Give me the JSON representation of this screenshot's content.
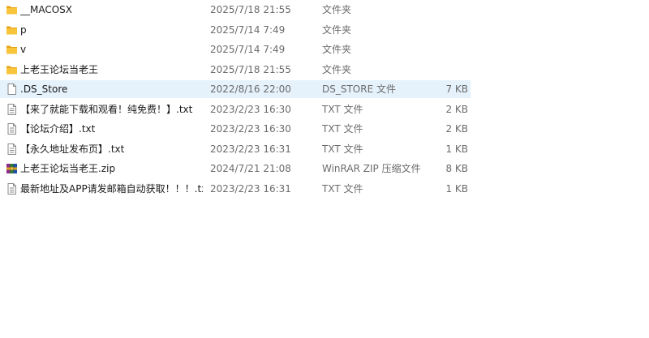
{
  "files": [
    {
      "name": "__MACOSX",
      "date": "2025/7/18 21:55",
      "type": "文件夹",
      "size": "",
      "icon": "folder-icon"
    },
    {
      "name": "p",
      "date": "2025/7/14 7:49",
      "type": "文件夹",
      "size": "",
      "icon": "folder-icon"
    },
    {
      "name": "v",
      "date": "2025/7/14 7:49",
      "type": "文件夹",
      "size": "",
      "icon": "folder-icon"
    },
    {
      "name": "上老王论坛当老王",
      "date": "2025/7/18 21:55",
      "type": "文件夹",
      "size": "",
      "icon": "folder-icon"
    },
    {
      "name": ".DS_Store",
      "date": "2022/8/16 22:00",
      "type": "DS_STORE 文件",
      "size": "7 KB",
      "icon": "file-icon"
    },
    {
      "name": "【来了就能下载和观看！纯免费！】.txt",
      "date": "2023/2/23 16:30",
      "type": "TXT 文件",
      "size": "2 KB",
      "icon": "text-file-icon"
    },
    {
      "name": "【论坛介绍】.txt",
      "date": "2023/2/23 16:30",
      "type": "TXT 文件",
      "size": "2 KB",
      "icon": "text-file-icon"
    },
    {
      "name": "【永久地址发布页】.txt",
      "date": "2023/2/23 16:31",
      "type": "TXT 文件",
      "size": "1 KB",
      "icon": "text-file-icon"
    },
    {
      "name": "上老王论坛当老王.zip",
      "date": "2024/7/21 21:08",
      "type": "WinRAR ZIP 压缩文件",
      "size": "8 KB",
      "icon": "winrar-archive-icon"
    },
    {
      "name": "最新地址及APP请发邮箱自动获取！！！.txt",
      "date": "2023/2/23 16:31",
      "type": "TXT 文件",
      "size": "1 KB",
      "icon": "text-file-icon"
    }
  ],
  "selected_index": 4
}
